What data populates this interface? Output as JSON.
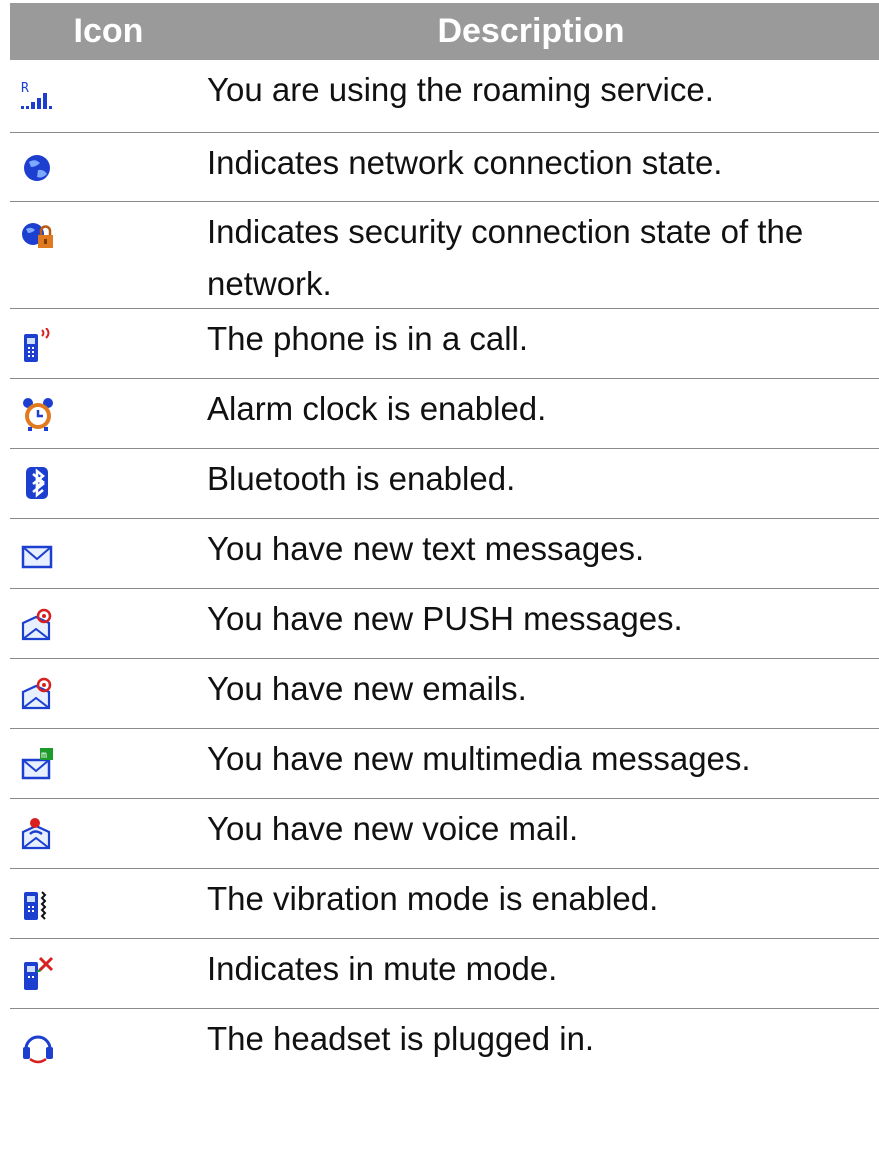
{
  "header": {
    "icon_label": "Icon",
    "description_label": "Description"
  },
  "rows": [
    {
      "icon": "roaming-icon",
      "description": "You are using the roaming service."
    },
    {
      "icon": "network-connection-icon",
      "description": "Indicates network connection state."
    },
    {
      "icon": "secure-network-connection-icon",
      "description": "Indicates security connection state of the network."
    },
    {
      "icon": "phone-in-call-icon",
      "description": "The phone is in a call."
    },
    {
      "icon": "alarm-clock-icon",
      "description": "Alarm clock is enabled."
    },
    {
      "icon": "bluetooth-icon",
      "description": "Bluetooth is enabled."
    },
    {
      "icon": "text-message-icon",
      "description": "You have new text messages."
    },
    {
      "icon": "push-message-icon",
      "description": "You have new PUSH messages."
    },
    {
      "icon": "email-icon",
      "description": "You have new emails."
    },
    {
      "icon": "multimedia-message-icon",
      "description": "You have new multimedia messages."
    },
    {
      "icon": "voice-mail-icon",
      "description": "You have new voice mail."
    },
    {
      "icon": "vibration-mode-icon",
      "description": "The vibration mode is enabled."
    },
    {
      "icon": "mute-mode-icon",
      "description": "Indicates in mute mode."
    },
    {
      "icon": "headset-icon",
      "description": "The headset is plugged in."
    }
  ],
  "colors": {
    "header_bg": "#9a9a9a",
    "rule": "#8a8a8a",
    "icon_blue": "#1c3fd0",
    "icon_red": "#d82020",
    "icon_orange": "#e07a20"
  }
}
